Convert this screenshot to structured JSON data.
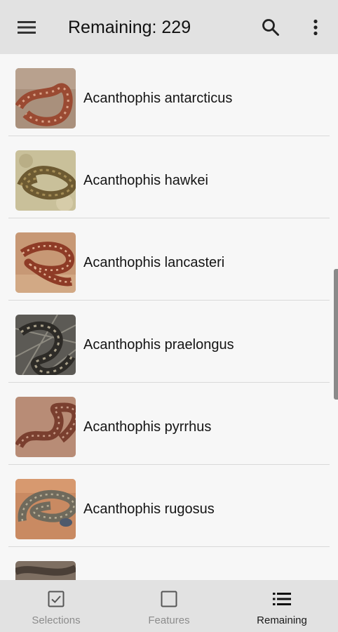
{
  "app_bar": {
    "title": "Remaining: 229",
    "menu_icon": "hamburger-menu-icon",
    "search_icon": "search-icon",
    "more_icon": "more-vert-icon"
  },
  "species": [
    {
      "name": "Acanthophis antarcticus"
    },
    {
      "name": "Acanthophis hawkei"
    },
    {
      "name": "Acanthophis lancasteri"
    },
    {
      "name": "Acanthophis praelongus"
    },
    {
      "name": "Acanthophis pyrrhus"
    },
    {
      "name": "Acanthophis rugosus"
    },
    {
      "name": ""
    }
  ],
  "bottom_nav": {
    "items": [
      {
        "label": "Selections",
        "icon": "checkbox-checked-icon",
        "active": false
      },
      {
        "label": "Features",
        "icon": "checkbox-empty-icon",
        "active": false
      },
      {
        "label": "Remaining",
        "icon": "list-icon",
        "active": true
      }
    ]
  },
  "colors": {
    "app_bar_bg": "#e2e2e2",
    "list_bg": "#f7f7f7",
    "divider": "#d9d9d9",
    "inactive_nav_text": "#8c8c8c",
    "active_nav_text": "#1a1a1a"
  }
}
